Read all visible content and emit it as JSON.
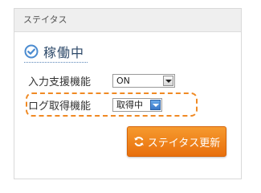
{
  "panel": {
    "title": "ステイタス"
  },
  "status": {
    "icon": "check-circle-icon",
    "text": "稼働中",
    "accent_color": "#4a8bd0"
  },
  "settings": [
    {
      "label": "入力支援機能",
      "selected_value": "ON"
    },
    {
      "label": "ログ取得機能",
      "selected_value": "取得中",
      "highlighted": true,
      "highlight_color": "#f08a24"
    }
  ],
  "update_button": {
    "icon": "refresh-icon",
    "label": "ステイタス更新",
    "color": "#ee7b14"
  }
}
